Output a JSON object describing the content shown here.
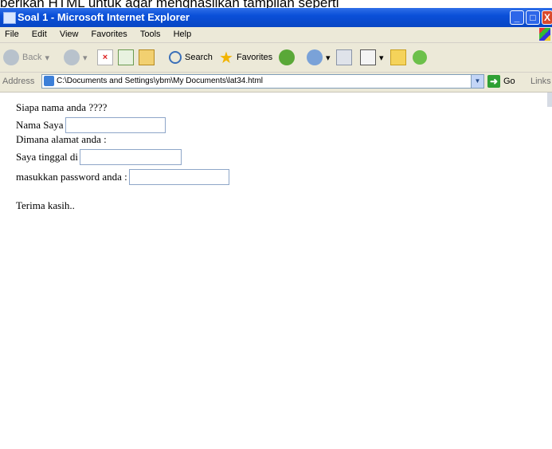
{
  "caption": "berikan HTML untuk agar menghasilkan tampilan seperti",
  "window": {
    "title": "Soal 1 - Microsoft Internet Explorer",
    "controls": {
      "minimize": "_",
      "maximize": "□",
      "close": "X"
    }
  },
  "menu": [
    "File",
    "Edit",
    "View",
    "Favorites",
    "Tools",
    "Help"
  ],
  "toolbar": {
    "back": "Back",
    "search": "Search",
    "favorites": "Favorites"
  },
  "address": {
    "label": "Address",
    "url": "C:\\Documents and Settings\\ybm\\My Documents\\lat34.html",
    "go": "Go",
    "links": "Links"
  },
  "page": {
    "line1": "Siapa nama anda ????",
    "name_label": "Nama Saya",
    "address_question": "Dimana alamat anda :",
    "live_label": "Saya tinggal di",
    "password_label": "masukkan password anda :",
    "thanks": "Terima kasih.."
  }
}
